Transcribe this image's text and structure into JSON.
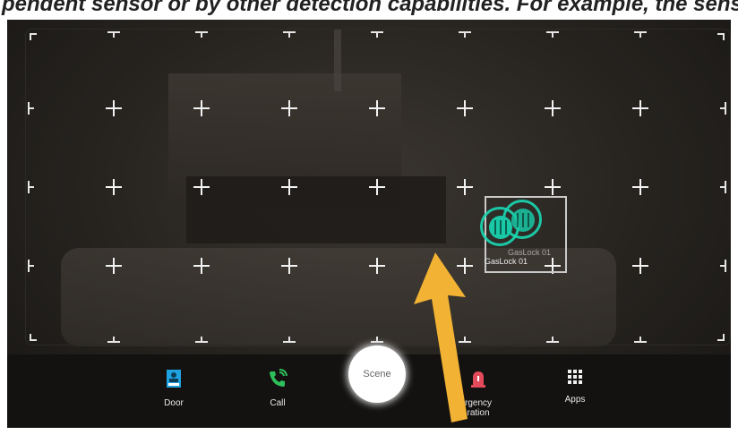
{
  "header": {
    "caption": "pendent sensor or by other detection capabilities. For example, the sensor"
  },
  "device": {
    "name": "GasLock 01",
    "shadow_name": "GasLock 01"
  },
  "dock": {
    "door_label": "Door",
    "call_label": "Call",
    "scene_label": "Scene",
    "emergency_label": "rgency",
    "emergency_label_line2": "ration",
    "apps_label": "Apps"
  },
  "colors": {
    "accent": "#19d9b4",
    "door_icon": "#1fa3e0",
    "call_icon": "#2fbf5a",
    "emergency_icon": "#e34a5a",
    "arrow": "#f2b233"
  },
  "icons": {
    "door": "door-icon",
    "call": "phone-call-icon",
    "emergency": "siren-icon",
    "apps": "grid-apps-icon",
    "device": "gas-lock-icon"
  }
}
